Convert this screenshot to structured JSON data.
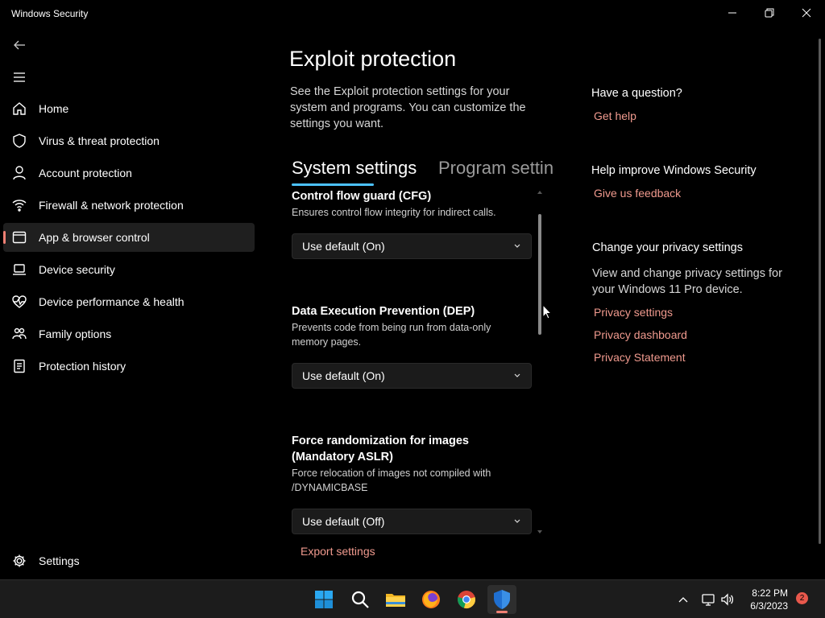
{
  "window": {
    "title": "Windows Security"
  },
  "nav": {
    "items": [
      {
        "label": "Home",
        "icon": "home-icon"
      },
      {
        "label": "Virus & threat protection",
        "icon": "shield-icon"
      },
      {
        "label": "Account protection",
        "icon": "person-icon"
      },
      {
        "label": "Firewall & network protection",
        "icon": "wifi-icon"
      },
      {
        "label": "App & browser control",
        "icon": "browser-icon",
        "active": true
      },
      {
        "label": "Device security",
        "icon": "laptop-icon"
      },
      {
        "label": "Device performance & health",
        "icon": "heart-icon"
      },
      {
        "label": "Family options",
        "icon": "family-icon"
      },
      {
        "label": "Protection history",
        "icon": "history-icon"
      }
    ],
    "settings_label": "Settings"
  },
  "main": {
    "title": "Exploit protection",
    "description": "See the Exploit protection settings for your system and programs.  You can customize the settings you want.",
    "tabs": [
      {
        "label": "System settings",
        "selected": true
      },
      {
        "label": "Program settings",
        "selected": false
      }
    ],
    "settings": [
      {
        "title": "Control flow guard (CFG)",
        "description": "Ensures control flow integrity for indirect calls.",
        "value": "Use default (On)"
      },
      {
        "title": "Data Execution Prevention (DEP)",
        "description": "Prevents code from being run from data-only memory pages.",
        "value": "Use default (On)"
      },
      {
        "title": "Force randomization for images (Mandatory ASLR)",
        "description": "Force relocation of images not compiled with /DYNAMICBASE",
        "value": "Use default (Off)"
      }
    ],
    "export_label": "Export settings"
  },
  "side": {
    "question_heading": "Have a question?",
    "get_help": "Get help",
    "improve_heading": "Help improve Windows Security",
    "feedback": "Give us feedback",
    "privacy_heading": "Change your privacy settings",
    "privacy_text": "View and change privacy settings for your Windows 11 Pro device.",
    "privacy_links": [
      "Privacy settings",
      "Privacy dashboard",
      "Privacy Statement"
    ]
  },
  "taskbar": {
    "apps": [
      "start-icon",
      "search-icon",
      "file-explorer-icon",
      "firefox-icon",
      "chrome-icon",
      "windows-security-icon"
    ],
    "time": "8:22 PM",
    "date": "6/3/2023",
    "notification_count": "2"
  },
  "colors": {
    "accent_link": "#f09a8e",
    "tab_underline": "#4cc2ff",
    "active_indicator": "#f08074"
  }
}
